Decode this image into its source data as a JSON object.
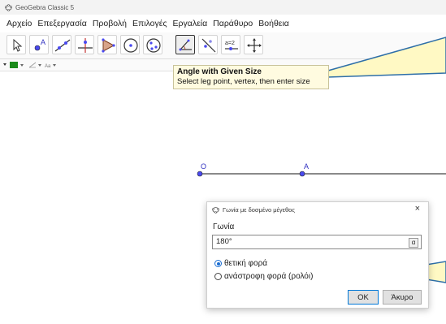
{
  "window": {
    "title": "GeoGebra Classic 5"
  },
  "menu": [
    "Αρχείο",
    "Επεξεργασία",
    "Προβολή",
    "Επιλογές",
    "Εργαλεία",
    "Παράθυρο",
    "Βοήθεια"
  ],
  "toolbar": {
    "tools": [
      {
        "icon": "move-arrow-icon"
      },
      {
        "icon": "point-icon",
        "label": "A"
      },
      {
        "icon": "line-icon"
      },
      {
        "icon": "perpendicular-line-icon"
      },
      {
        "icon": "polygon-icon"
      },
      {
        "icon": "circle-center-point-icon"
      },
      {
        "icon": "conic-icon"
      },
      {
        "icon": "angle-given-size-icon",
        "active": true
      },
      {
        "icon": "reflect-about-line-icon"
      },
      {
        "icon": "slider-icon",
        "label": "a=2"
      },
      {
        "icon": "move-graphics-view-icon"
      }
    ]
  },
  "stylebar": {
    "accent_color": "#1a8a1a"
  },
  "tooltip": {
    "title": "Angle with Given Size",
    "description": "Select leg point, vertex, then enter size"
  },
  "canvas": {
    "points": [
      {
        "label": "O",
        "color": "#4a4af0"
      },
      {
        "label": "A",
        "color": "#4a4af0"
      }
    ]
  },
  "dialog": {
    "title": "Γωνία με δοσμένο μέγεθος",
    "field_label": "Γωνία",
    "input_value": "180°",
    "alpha_symbol": "α",
    "options": [
      {
        "label": "θετική φορά",
        "selected": true
      },
      {
        "label": "ανάστροφη φορά (ρολόι)",
        "selected": false
      }
    ],
    "ok_label": "OK",
    "cancel_label": "Άκυρο",
    "close_symbol": "×"
  },
  "colors": {
    "callout_fill": "#fff9c4",
    "callout_stroke": "#2e6fa8"
  }
}
